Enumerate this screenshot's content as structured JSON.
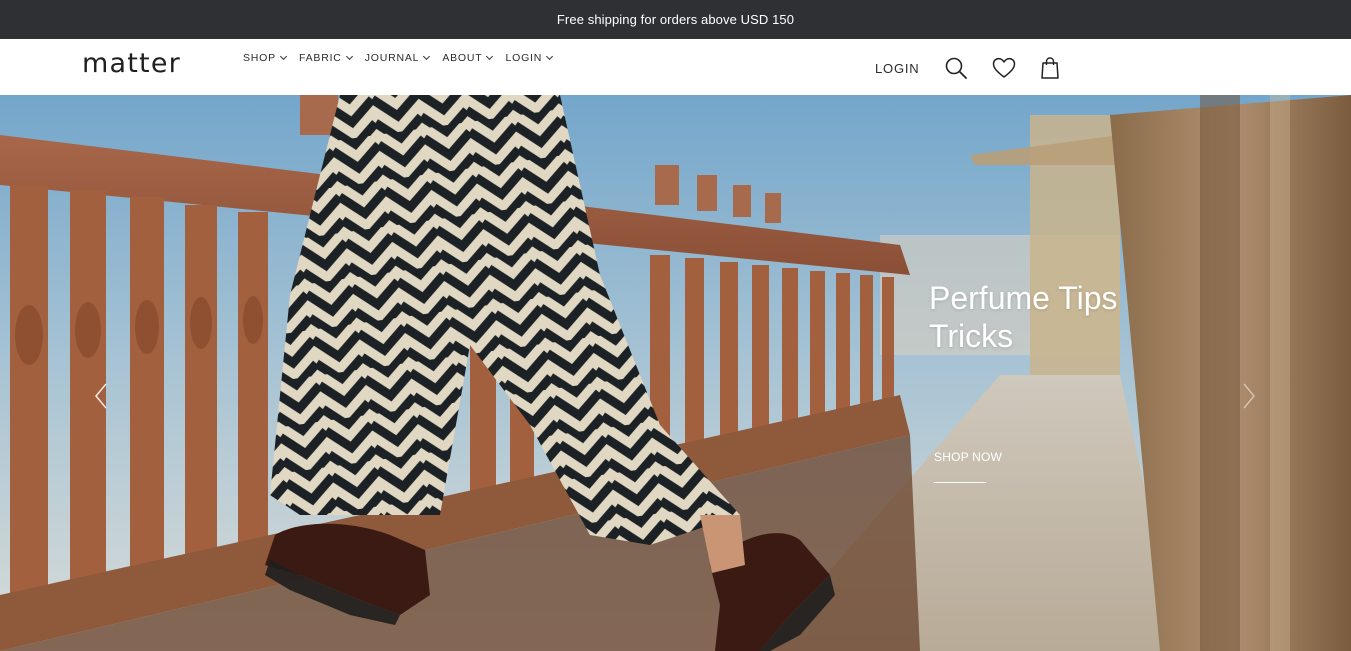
{
  "announcement": {
    "text": "Free shipping for orders above USD 150"
  },
  "header": {
    "logo": "matter",
    "nav": [
      {
        "label": "SHOP"
      },
      {
        "label": "FABRIC"
      },
      {
        "label": "JOURNAL"
      },
      {
        "label": "ABOUT"
      },
      {
        "label": "LOGIN"
      }
    ],
    "login_label": "LOGIN",
    "icons": [
      "search-icon",
      "heart-icon",
      "shopping-bag-icon"
    ]
  },
  "hero": {
    "title_line1": "Perfume Tips",
    "title_line2": "Tricks",
    "cta_label": "SHOP NOW",
    "arrows": [
      "chevron-left-icon",
      "chevron-right-icon"
    ]
  },
  "colors": {
    "announcement_bg": "#2f3034",
    "header_bg": "#ffffff",
    "text_dark": "#2b2b2b",
    "hero_text": "#ffffff"
  }
}
